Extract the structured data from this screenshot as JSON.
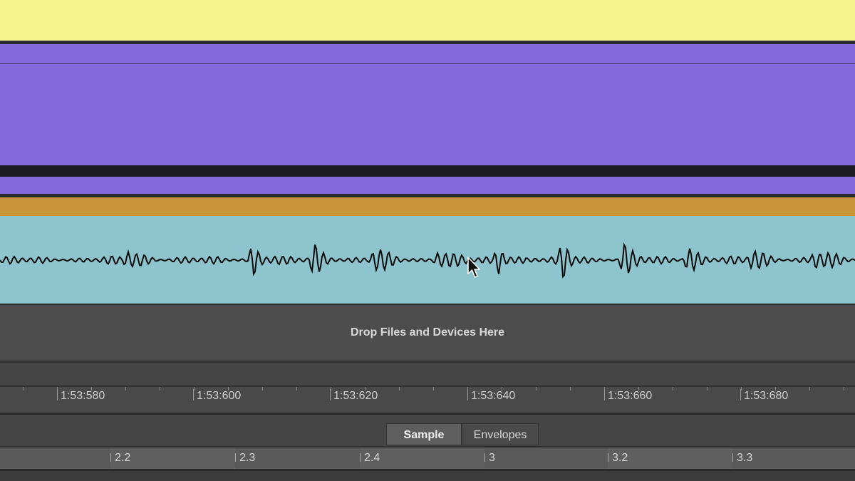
{
  "colors": {
    "clip_yellow": "#f4f48a",
    "clip_purple": "#8369d9",
    "clip_orange": "#c9963b",
    "waveform_bg": "#8dc4cd",
    "waveform_line": "#0a0a0a"
  },
  "drop_zone": {
    "label": "Drop Files and Devices Here"
  },
  "time_ruler": {
    "labels": [
      "1:53:580",
      "1:53:600",
      "1:53:620",
      "1:53:640",
      "1:53:660",
      "1:53:680"
    ]
  },
  "detail_tabs": {
    "sample": "Sample",
    "envelopes": "Envelopes",
    "active": "Sample"
  },
  "beat_ruler": {
    "labels": [
      "2.2",
      "2.3",
      "2.4",
      "3",
      "3.2",
      "3.3"
    ]
  },
  "icons": {
    "cursor": "mouse-pointer-icon"
  }
}
